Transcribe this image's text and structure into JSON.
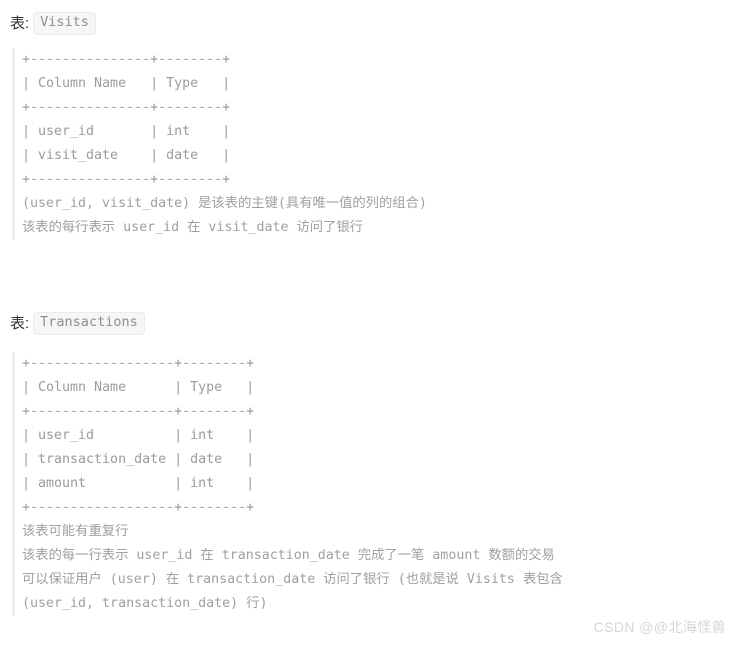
{
  "page": {
    "background": "#ffffff",
    "text_color": "#9b9b9b",
    "heading_color": "#333333",
    "rule_color": "#ececec"
  },
  "sections": [
    {
      "id": "visits",
      "label": "表:",
      "name": "Visits",
      "ascii_table": "+---------------+--------+\n| Column Name   | Type   |\n+---------------+--------+\n| user_id       | int    |\n| visit_date    | date   |\n+---------------+--------+",
      "columns": [
        {
          "name": "Column Name",
          "type": "Type"
        },
        {
          "name": "user_id",
          "type": "int"
        },
        {
          "name": "visit_date",
          "type": "date"
        }
      ],
      "notes": [
        "(user_id, visit_date) 是该表的主键(具有唯一值的列的组合)",
        "该表的每行表示 user_id 在 visit_date 访问了银行"
      ]
    },
    {
      "id": "transactions",
      "label": "表:",
      "name": "Transactions",
      "ascii_table": "+------------------+--------+\n| Column Name      | Type   |\n+------------------+--------+\n| user_id          | int    |\n| transaction_date | date   |\n| amount           | int    |\n+------------------+--------+",
      "columns": [
        {
          "name": "Column Name",
          "type": "Type"
        },
        {
          "name": "user_id",
          "type": "int"
        },
        {
          "name": "transaction_date",
          "type": "date"
        },
        {
          "name": "amount",
          "type": "int"
        }
      ],
      "notes": [
        "该表可能有重复行",
        "该表的每一行表示 user_id 在 transaction_date 完成了一笔 amount 数额的交易",
        "可以保证用户 (user) 在 transaction_date 访问了银行 (也就是说 Visits 表包含",
        "(user_id, transaction_date) 行)"
      ]
    }
  ],
  "watermark": {
    "text": "CSDN @@北海怪兽"
  }
}
